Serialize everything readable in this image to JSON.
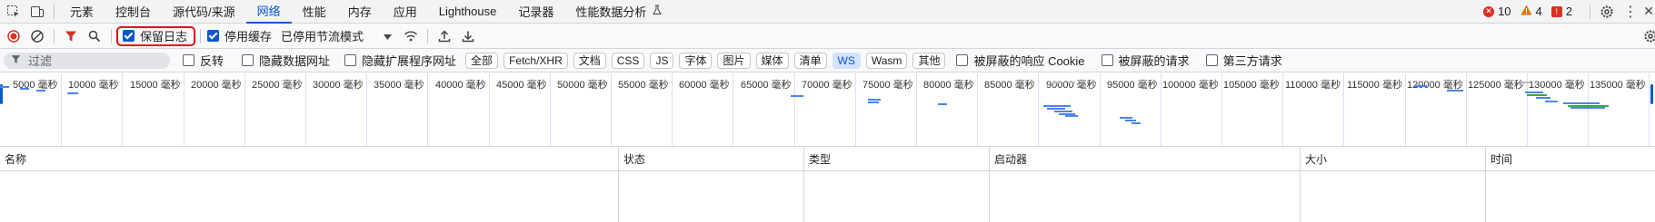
{
  "tabs": {
    "elements": "元素",
    "console": "控制台",
    "sources": "源代码/来源",
    "network": "网络",
    "performance": "性能",
    "memory": "内存",
    "application": "应用",
    "lighthouse": "Lighthouse",
    "recorder": "记录器",
    "perf_insights": "性能数据分析"
  },
  "status": {
    "errors": "10",
    "warnings": "4",
    "issues": "2"
  },
  "toolbar": {
    "preserve_log": "保留日志",
    "disable_cache": "停用缓存",
    "throttling": "已停用节流模式"
  },
  "filter": {
    "placeholder": "过滤",
    "invert": "反转",
    "hide_data_urls": "隐藏数据网址",
    "hide_ext_urls": "隐藏扩展程序网址",
    "types": [
      "全部",
      "Fetch/XHR",
      "文档",
      "CSS",
      "JS",
      "字体",
      "图片",
      "媒体",
      "清单",
      "WS",
      "Wasm",
      "其他"
    ],
    "selected_type": "WS",
    "blocked_cookies": "被屏蔽的响应 Cookie",
    "blocked_requests": "被屏蔽的请求",
    "third_party": "第三方请求"
  },
  "overview": {
    "ticks": [
      "5000 毫秒",
      "10000 毫秒",
      "15000 毫秒",
      "20000 毫秒",
      "25000 毫秒",
      "30000 毫秒",
      "35000 毫秒",
      "40000 毫秒",
      "45000 毫秒",
      "50000 毫秒",
      "55000 毫秒",
      "60000 毫秒",
      "65000 毫秒",
      "70000 毫秒",
      "75000 毫秒",
      "80000 毫秒",
      "85000 毫秒",
      "90000 毫秒",
      "95000 毫秒",
      "100000 毫秒",
      "105000 毫秒",
      "110000 毫秒",
      "115000 毫秒",
      "120000 毫秒",
      "125000 毫秒",
      "130000 毫秒",
      "135000 毫秒"
    ]
  },
  "columns": {
    "name": "名称",
    "status": "状态",
    "type": "类型",
    "initiator": "启动器",
    "size": "大小",
    "time": "时间"
  },
  "colors": {
    "accent": "#0b57d0",
    "error": "#d93025",
    "warning": "#e37400"
  }
}
